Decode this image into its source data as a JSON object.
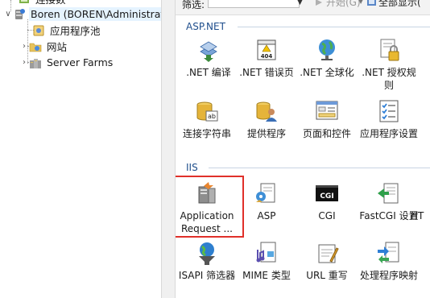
{
  "tree": {
    "top_item": "连接数",
    "server": "Boren (BOREN\\Administrat",
    "app_pools": "应用程序池",
    "sites": "网站",
    "server_farms": "Server Farms"
  },
  "filter": {
    "label": "筛选:",
    "go_label": "开始(G)",
    "show_all_label": "全部显示("
  },
  "groups": {
    "aspnet": "ASP.NET",
    "iis": "IIS"
  },
  "tiles": {
    "net_compile": ".NET 编译",
    "net_error_pages": ".NET 错误页",
    "net_globalization": ".NET 全球化",
    "net_authorization": ".NET 授权规则",
    "connection_strings": "连接字符串",
    "providers": "提供程序",
    "pages_controls": "页面和控件",
    "app_settings": "应用程序设置",
    "arr": "Application Request ...",
    "asp": "ASP",
    "cgi": "CGI",
    "fastcgi": "FastCGI 设置",
    "ht_partial": "HT",
    "isapi_filters": "ISAPI 筛选器",
    "mime_types": "MIME 类型",
    "url_rewrite": "URL 重写",
    "handler_mappings": "处理程序映射"
  },
  "icons": {
    "cgi_text": "CGI",
    "error_page_text": "404",
    "connstr_text": "ab"
  },
  "colors": {
    "highlight_border": "#e0302a",
    "group_header": "#1f4e8c"
  }
}
